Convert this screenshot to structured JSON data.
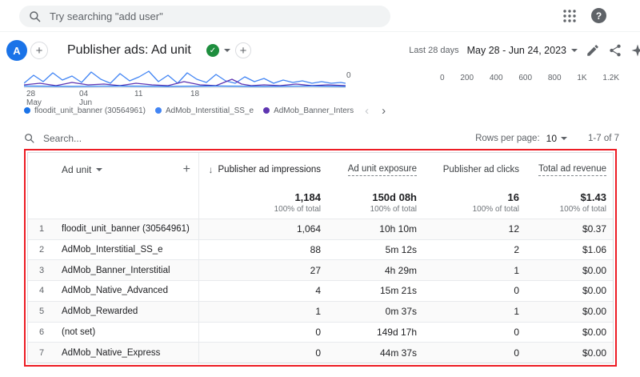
{
  "colors": {
    "accent_blue": "#1a73e8",
    "success_green": "#1e8e3e",
    "annotation_red": "#ed1c24"
  },
  "icons": {
    "sort_desc": "↓",
    "chevron_left": "‹",
    "chevron_right": "›",
    "plus": "+",
    "help": "?",
    "check": "✓"
  },
  "topbar": {
    "search_placeholder": "Try searching \"add user\""
  },
  "header": {
    "avatar_letter": "A",
    "title": "Publisher ads: Ad unit",
    "date_range_label": "Last 28 days",
    "date_range": "May 28 - Jun 24, 2023"
  },
  "chart": {
    "x_ticks": [
      {
        "day": "28",
        "month": "May"
      },
      {
        "day": "04",
        "month": "Jun"
      },
      {
        "day": "11",
        "month": ""
      },
      {
        "day": "18",
        "month": ""
      }
    ],
    "y_zero": "0",
    "right_axis_ticks": [
      "0",
      "200",
      "400",
      "600",
      "800",
      "1K",
      "1.2K"
    ],
    "series_colors": [
      "#4285f4",
      "#5e35b1",
      "#1a73e8"
    ]
  },
  "legend": {
    "items": [
      {
        "label": "floodit_unit_banner (30564961)",
        "color": "#1a73e8"
      },
      {
        "label": "AdMob_Interstitial_SS_e",
        "color": "#4285f4"
      },
      {
        "label": "AdMob_Banner_Interstitial",
        "color": "#5e35b1"
      }
    ]
  },
  "controls": {
    "search_placeholder": "Search...",
    "rows_per_page_label": "Rows per page:",
    "rows_per_page_value": "10",
    "pagination": "1-7 of 7"
  },
  "table": {
    "dimension_header": "Ad unit",
    "headers": {
      "impressions": "Publisher ad impressions",
      "exposure": "Ad unit exposure",
      "clicks": "Publisher ad clicks",
      "revenue": "Total ad revenue"
    },
    "totals": {
      "impressions": "1,184",
      "exposure": "150d 08h",
      "clicks": "16",
      "revenue": "$1.43",
      "pct": "100% of total"
    },
    "rows": [
      {
        "num": "1",
        "name": "floodit_unit_banner (30564961)",
        "impressions": "1,064",
        "exposure": "10h 10m",
        "clicks": "12",
        "revenue": "$0.37"
      },
      {
        "num": "2",
        "name": "AdMob_Interstitial_SS_e",
        "impressions": "88",
        "exposure": "5m 12s",
        "clicks": "2",
        "revenue": "$1.06"
      },
      {
        "num": "3",
        "name": "AdMob_Banner_Interstitial",
        "impressions": "27",
        "exposure": "4h 29m",
        "clicks": "1",
        "revenue": "$0.00"
      },
      {
        "num": "4",
        "name": "AdMob_Native_Advanced",
        "impressions": "4",
        "exposure": "15m 21s",
        "clicks": "0",
        "revenue": "$0.00"
      },
      {
        "num": "5",
        "name": "AdMob_Rewarded",
        "impressions": "1",
        "exposure": "0m 37s",
        "clicks": "1",
        "revenue": "$0.00"
      },
      {
        "num": "6",
        "name": "(not set)",
        "impressions": "0",
        "exposure": "149d 17h",
        "clicks": "0",
        "revenue": "$0.00"
      },
      {
        "num": "7",
        "name": "AdMob_Native_Express",
        "impressions": "0",
        "exposure": "44m 37s",
        "clicks": "0",
        "revenue": "$0.00"
      }
    ]
  }
}
